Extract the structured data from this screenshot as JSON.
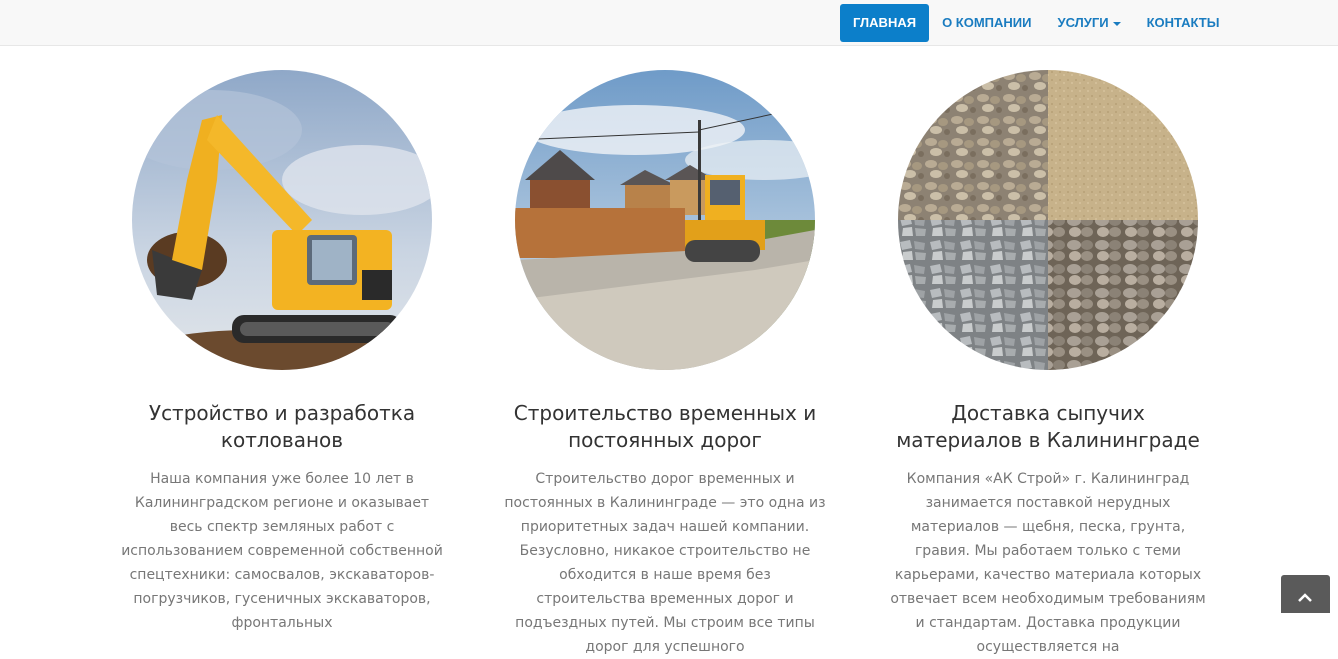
{
  "nav": {
    "items": [
      {
        "label": "ГЛАВНАЯ",
        "active": true
      },
      {
        "label": "О КОМПАНИИ"
      },
      {
        "label": "УСЛУГИ",
        "dropdown": true
      },
      {
        "label": "КОНТАКТЫ"
      }
    ]
  },
  "services": [
    {
      "title": "Устройство и разработка котлованов",
      "text": "Наша компания уже более 10 лет в Калининградском регионе и оказывает весь спектр земляных работ с использованием современной собственной спецтехники: самосвалов, экскаваторов-погрузчиков, гусеничных экскаваторов, фронтальных"
    },
    {
      "title": "Строительство временных и постоянных дорог",
      "text": "Строительство дорог временных и постоянных в Калининграде — это одна из приоритетных задач нашей компании. Безусловно, никакое строительство не обходится в наше время без строительства временных дорог и подъездных путей. Мы строим все типы дорог для успешного"
    },
    {
      "title": "Доставка сыпучих материалов в Калининграде",
      "text": "Компания «АК Строй» г. Калининград занимается поставкой нерудных материалов — щебня, песка, грунта, гравия. Мы работаем только с теми карьерами, качество материала которых отвечает всем необходимым требованиям и стандартам. Доставка продукции осуществляется на"
    }
  ],
  "colors": {
    "nav_active_bg": "#0c7fca",
    "nav_link": "#1a7cc0",
    "scroll_button": "#5a5a5a"
  },
  "icons": {
    "dropdown": "caret-down-icon",
    "scroll_top": "chevron-up-icon"
  }
}
